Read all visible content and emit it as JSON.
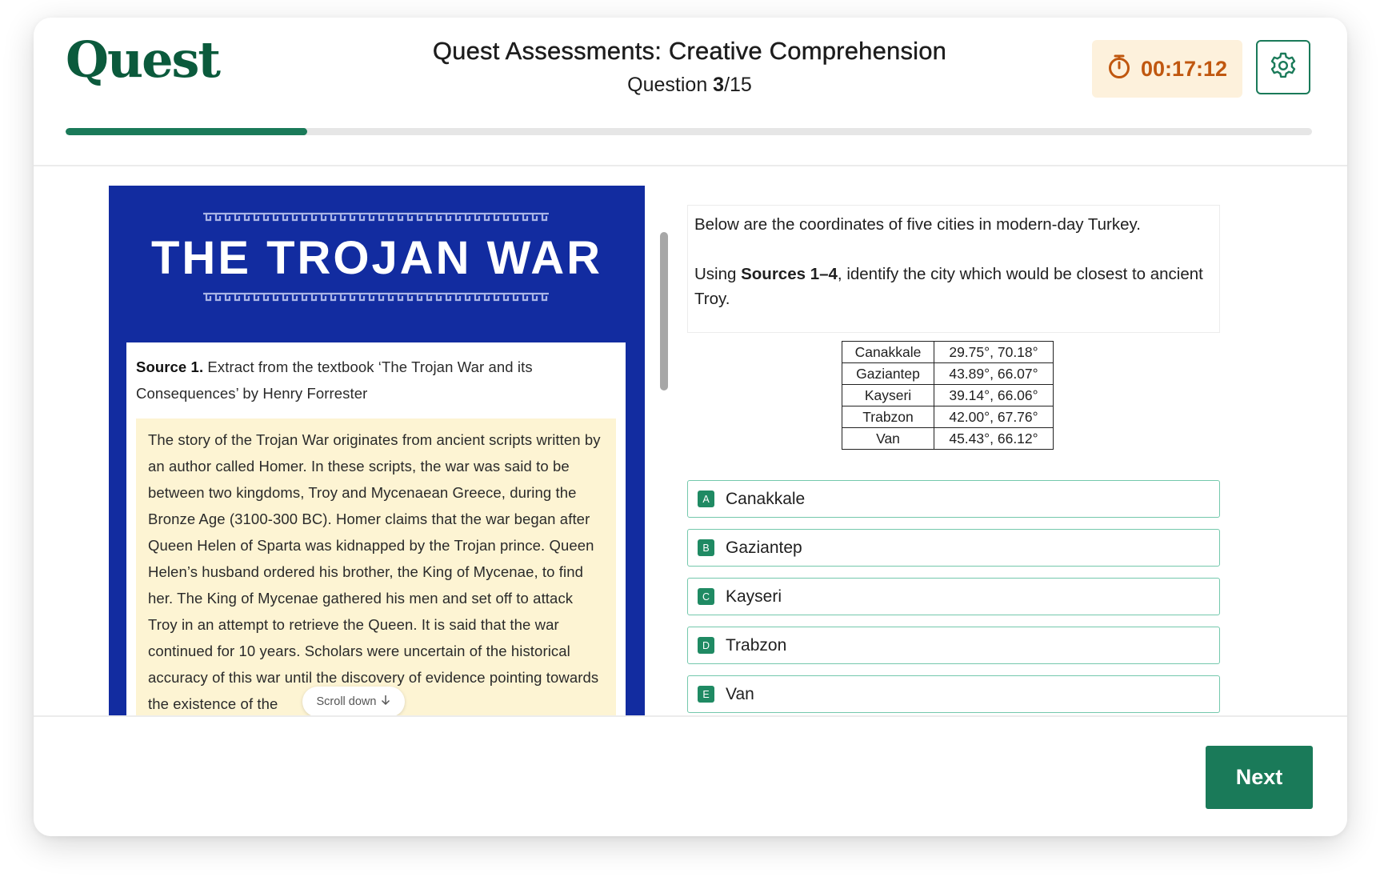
{
  "header": {
    "logo": "Quest",
    "title": "Quest Assessments: Creative Comprehension",
    "question_prefix": "Question ",
    "question_current": "3",
    "question_total": "/15",
    "timer": "00:17:12",
    "progress_fraction": 0.194
  },
  "source": {
    "heading": "THE TROJAN WAR",
    "caption_label": "Source 1.",
    "caption_text": " Extract from the textbook ‘The Trojan War and its Consequences’ by Henry Forrester",
    "extract": "The story of the Trojan War originates from ancient scripts written by an author called Homer. In these scripts, the war was said to be between two kingdoms, Troy and Mycenaean Greece, during the Bronze Age (3100-300 BC). Homer claims that the war began after Queen Helen of Sparta was kidnapped by the Trojan prince. Queen Helen’s husband ordered his brother, the King of Mycenae, to find her. The King of Mycenae gathered his men and set off to attack Troy in an attempt to retrieve the Queen. It is said that the war continued for 10 years. Scholars were uncertain of the historical accuracy of this war until the discovery of evidence pointing towards the existence of the",
    "scroll_hint": "Scroll down"
  },
  "question": {
    "intro": "Below are the coordinates of five cities in modern-day Turkey.",
    "instruction_prefix": "Using ",
    "instruction_bold": "Sources 1–4",
    "instruction_suffix": ", identify the city which would be closest to ancient Troy.",
    "table": [
      {
        "city": "Canakkale",
        "coords": "29.75°, 70.18°"
      },
      {
        "city": "Gaziantep",
        "coords": "43.89°, 66.07°"
      },
      {
        "city": "Kayseri",
        "coords": "39.14°, 66.06°"
      },
      {
        "city": "Trabzon",
        "coords": "42.00°, 67.76°"
      },
      {
        "city": "Van",
        "coords": "45.43°, 66.12°"
      }
    ],
    "options": [
      {
        "letter": "A",
        "label": "Canakkale"
      },
      {
        "letter": "B",
        "label": "Gaziantep"
      },
      {
        "letter": "C",
        "label": "Kayseri"
      },
      {
        "letter": "D",
        "label": "Trabzon"
      },
      {
        "letter": "E",
        "label": "Van"
      }
    ]
  },
  "footer": {
    "next_label": "Next"
  },
  "colors": {
    "brand_green": "#1a7a59",
    "panel_blue": "#122ca0",
    "timer_bg": "#fdf1dc",
    "timer_text": "#c0570f",
    "extract_bg": "#fdf4d3"
  }
}
